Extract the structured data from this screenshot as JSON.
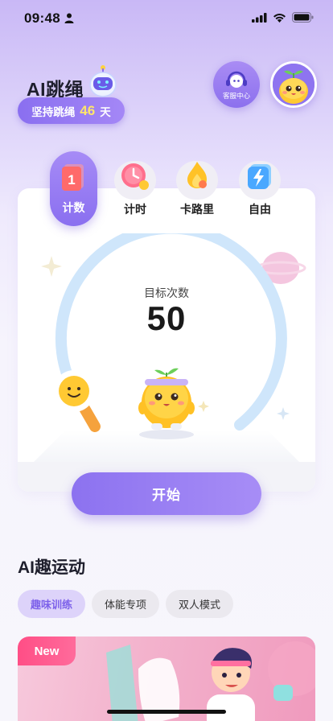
{
  "status": {
    "time": "09:48"
  },
  "header": {
    "title": "AI跳绳",
    "streak_prefix": "坚持跳绳",
    "streak_days": "46",
    "streak_suffix": "天",
    "service_label": "客服中心"
  },
  "modes": [
    {
      "label": "计数",
      "icon": "counter-icon",
      "active": true
    },
    {
      "label": "计时",
      "icon": "clock-icon",
      "active": false
    },
    {
      "label": "卡路里",
      "icon": "flame-icon",
      "active": false
    },
    {
      "label": "自由",
      "icon": "lightning-icon",
      "active": false
    }
  ],
  "gauge": {
    "target_label": "目标次数",
    "target_value": "50",
    "progress": 0.0
  },
  "start_button": "开始",
  "section": {
    "title": "AI趣运动",
    "chips": [
      "趣味训练",
      "体能专项",
      "双人模式"
    ],
    "active_chip": 0
  },
  "banner": {
    "tag": "New"
  },
  "colors": {
    "primary": "#8a6ff0",
    "accent_yellow": "#ffe66a",
    "new_tag": "#ff4e86",
    "gauge_ring": "#cfe6fb"
  }
}
